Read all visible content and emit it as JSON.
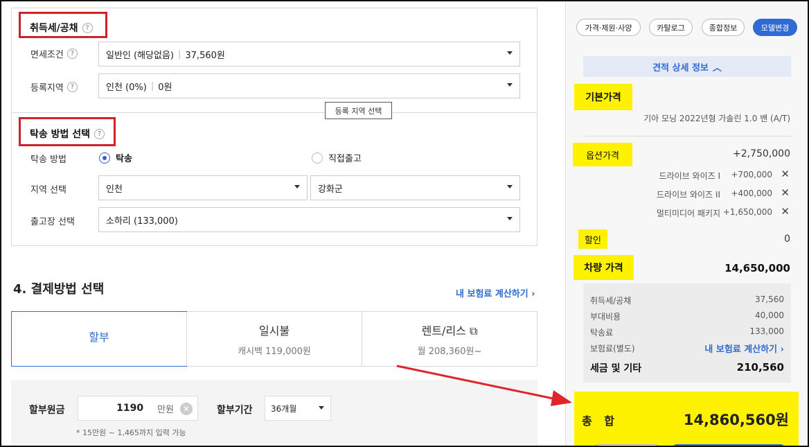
{
  "tax": {
    "title": "취득세/공채",
    "help": "?",
    "rows": [
      {
        "label": "면세조건",
        "value": "일반인 (해당없음)",
        "amount": "37,560원"
      },
      {
        "label": "등록지역",
        "value": "인천 (0%)",
        "amount": "0원"
      }
    ],
    "tooltip": "등록 지역 선택"
  },
  "delivery": {
    "title": "탁송 방법 선택",
    "method_label": "탁송 방법",
    "option_delivery": "탁송",
    "option_pickup": "직접출고",
    "region_label": "지역 선택",
    "region_value": "인천",
    "district_value": "강화군",
    "center_label": "출고장 선택",
    "center_value": "소하리 (133,000)"
  },
  "payment": {
    "heading": "4. 결제방법 선택",
    "insurance_link": "내 보험료 계산하기 ›",
    "tabs": [
      {
        "title": "할부",
        "sub": ""
      },
      {
        "title": "일시불",
        "sub": "캐시백 119,000원"
      },
      {
        "title": "렌트/리스 ⧉",
        "sub": "월 208,360원~"
      }
    ],
    "principal_label": "할부원금",
    "principal_value": "1190",
    "principal_unit": "만원",
    "period_label": "할부기간",
    "period_value": "36개월",
    "hint": "* 15만원 ~ 1,465까지 입력 가능"
  },
  "side": {
    "buttons": [
      "가격·제원·사양",
      "카탈로그",
      "종합정보",
      "모델변경"
    ],
    "detail_toggle": "견적 상세 정보",
    "base_label": "기본가격",
    "base_desc": "기아 모닝 2022년형 가솔린 1.0 밴 (A/T)",
    "option_label": "옵션가격",
    "option_total": "+2,750,000",
    "options": [
      {
        "name": "드라이브 와이즈 I",
        "price": "+700,000"
      },
      {
        "name": "드라이브 와이즈 II",
        "price": "+400,000"
      },
      {
        "name": "멀티미디어 패키지",
        "price": "+1,650,000"
      }
    ],
    "discount_label": "할인",
    "discount_value": "0",
    "car_price_label": "차량 가격",
    "car_price_value": "14,650,000",
    "fees": [
      {
        "name": "취득세/공채",
        "value": "37,560"
      },
      {
        "name": "부대비용",
        "value": "40,000"
      },
      {
        "name": "탁송료",
        "value": "133,000"
      }
    ],
    "insurance_label": "보험료(별도)",
    "insurance_link": "내 보험료 계산하기 ›",
    "tax_total_label": "세금 및 기타",
    "tax_total_value": "210,560",
    "total_label": "총 합",
    "total_value": "14,860,560원"
  },
  "colors": {
    "accent": "#2f6bd1",
    "highlight": "#fff200",
    "annotation": "#d0202a"
  }
}
